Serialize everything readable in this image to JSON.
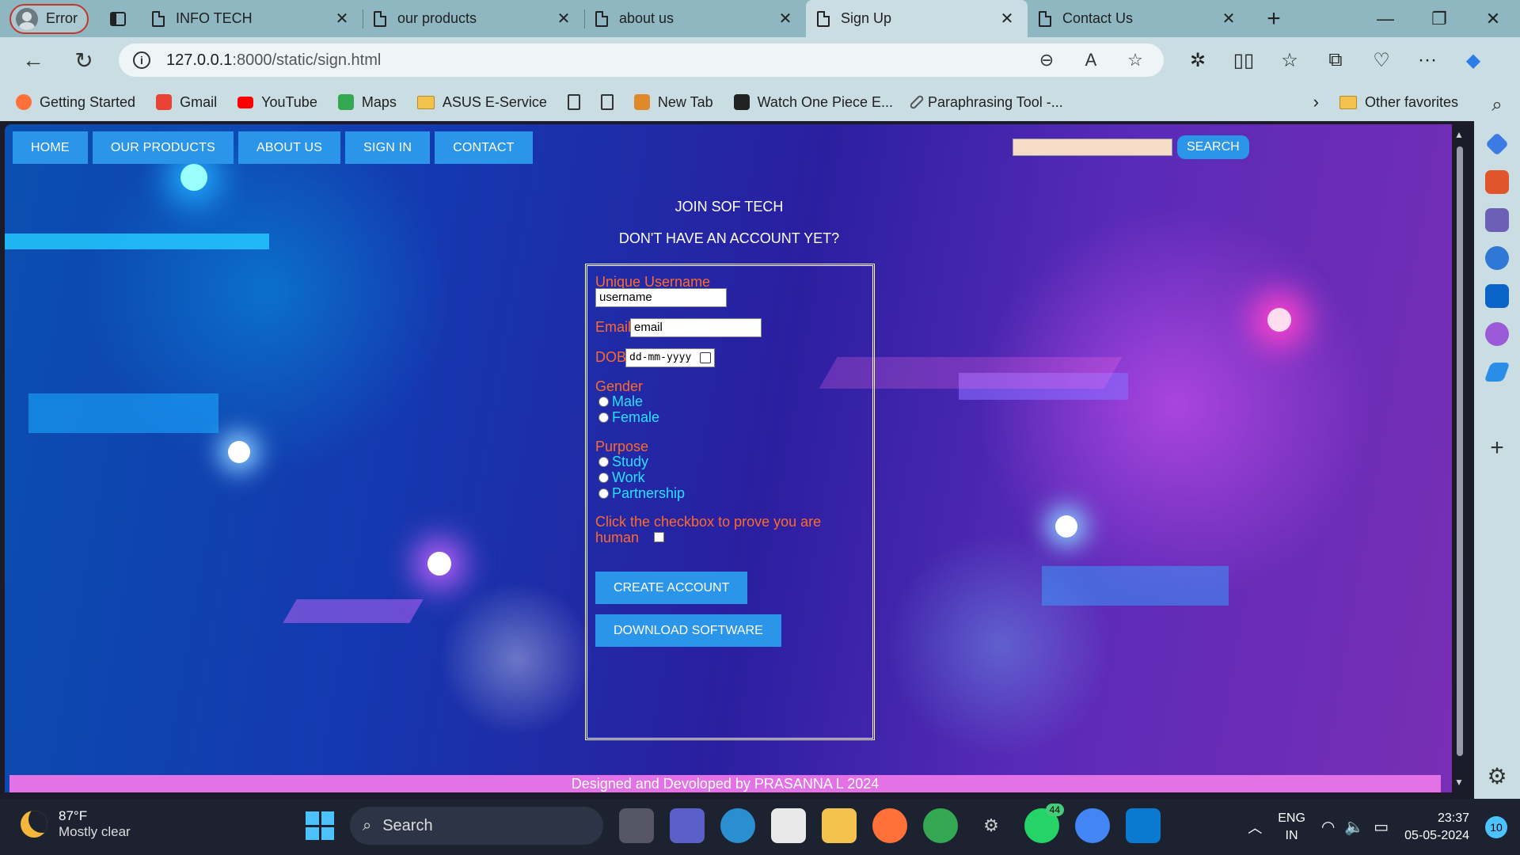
{
  "browser": {
    "profile_label": "Error",
    "tabs": [
      {
        "title": "INFO TECH"
      },
      {
        "title": "our products"
      },
      {
        "title": "about us"
      },
      {
        "title": "Sign Up",
        "active": true
      },
      {
        "title": "Contact Us"
      }
    ],
    "url_host": "127.0.0.1",
    "url_path": ":8000/static/sign.html",
    "bookmarks": [
      "Getting Started",
      "Gmail",
      "YouTube",
      "Maps",
      "ASUS E-Service",
      "New Tab",
      "Watch One Piece E...",
      "Paraphrasing Tool -..."
    ],
    "other_favorites": "Other favorites"
  },
  "page": {
    "nav": [
      "HOME",
      "OUR PRODUCTS",
      "ABOUT US",
      "SIGN IN",
      "CONTACT"
    ],
    "search_button": "SEARCH",
    "join_title": "JOIN SOF TECH",
    "join_sub": "DON'T HAVE AN ACCOUNT YET?",
    "form": {
      "username_label": "Unique Username",
      "username_value": "username",
      "email_label": "Email",
      "email_value": "email",
      "dob_label": "DOB",
      "dob_placeholder": "dd-mm-yyyy",
      "gender_label": "Gender",
      "gender_options": [
        "Male",
        "Female"
      ],
      "purpose_label": "Purpose",
      "purpose_options": [
        "Study",
        "Work",
        "Partnership"
      ],
      "human_check_label": "Click the checkbox to prove you are human",
      "create_button": "CREATE ACCOUNT",
      "download_button": "DOWNLOAD SOFTWARE"
    },
    "footer": "Designed and Devoloped by PRASANNA L 2024"
  },
  "taskbar": {
    "weather_temp": "87°F",
    "weather_desc": "Mostly clear",
    "search_label": "Search",
    "whatsapp_badge": "44",
    "lang_top": "ENG",
    "lang_bottom": "IN",
    "time": "23:37",
    "date": "05-05-2024",
    "notifications": "10"
  },
  "colors": {
    "nav_blue": "#2b95e9",
    "label_orange": "#ff6a2b",
    "option_cyan": "#2be0ff",
    "footer_pink": "#e272e6"
  }
}
